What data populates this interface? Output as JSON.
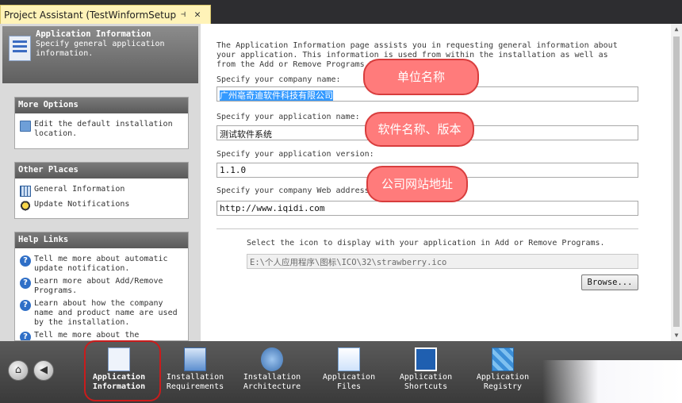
{
  "tab": {
    "title": "Project Assistant (TestWinformSetup)",
    "pin": "⊣",
    "close": "✕"
  },
  "header": {
    "title": "Application Information",
    "description": "Specify general application information."
  },
  "more_options": {
    "title": "More Options",
    "items": [
      {
        "label": "Edit the default installation location.",
        "icon": "folder-icon"
      }
    ]
  },
  "other_places": {
    "title": "Other Places",
    "items": [
      {
        "label": "General Information",
        "icon": "grid-icon"
      },
      {
        "label": "Update Notifications",
        "icon": "update-icon"
      }
    ]
  },
  "help_links": {
    "title": "Help Links",
    "items": [
      {
        "label": "Tell me more about automatic update notification."
      },
      {
        "label": "Learn more about Add/Remove Programs."
      },
      {
        "label": "Learn about how the company name and product name are used by the installation."
      },
      {
        "label": "Tell me more about the"
      }
    ]
  },
  "content": {
    "intro": "The Application Information page assists you in requesting general information about your application. This information is used from within the installation as well as from the Add or Remove Programs Panel.",
    "company_label": "Specify your company name:",
    "company_value": "广州亳奇迪软件科技有限公司",
    "app_name_label": "Specify your application name:",
    "app_name_value": "测试软件系统",
    "version_label": "Specify your application version:",
    "version_value": "1.1.0",
    "web_label": "Specify your company Web address:",
    "web_value": "http://www.iqidi.com",
    "icon_label": "Select the icon to display with your application in Add or Remove Programs.",
    "icon_path": "E:\\个人应用程序\\图标\\ICO\\32\\strawberry.ico",
    "browse_label": "Browse..."
  },
  "callouts": {
    "company": "单位名称",
    "app": "软件名称、版本",
    "web": "公司网站地址"
  },
  "nav": {
    "steps": [
      {
        "line1": "Application",
        "line2": "Information",
        "active": true,
        "icon": "application-info-icon"
      },
      {
        "line1": "Installation",
        "line2": "Requirements",
        "active": false,
        "icon": "requirements-icon"
      },
      {
        "line1": "Installation",
        "line2": "Architecture",
        "active": false,
        "icon": "architecture-icon"
      },
      {
        "line1": "Application",
        "line2": "Files",
        "active": false,
        "icon": "files-icon"
      },
      {
        "line1": "Application",
        "line2": "Shortcuts",
        "active": false,
        "icon": "shortcuts-icon"
      },
      {
        "line1": "Application",
        "line2": "Registry",
        "active": false,
        "icon": "registry-icon"
      }
    ],
    "home_icon": "home-icon",
    "back_icon": "back-icon"
  },
  "colors": {
    "callout_fill": "#ff7b7b",
    "callout_border": "#d83d3d",
    "highlight_ring": "#c91c1c",
    "selection": "#3399ff"
  }
}
